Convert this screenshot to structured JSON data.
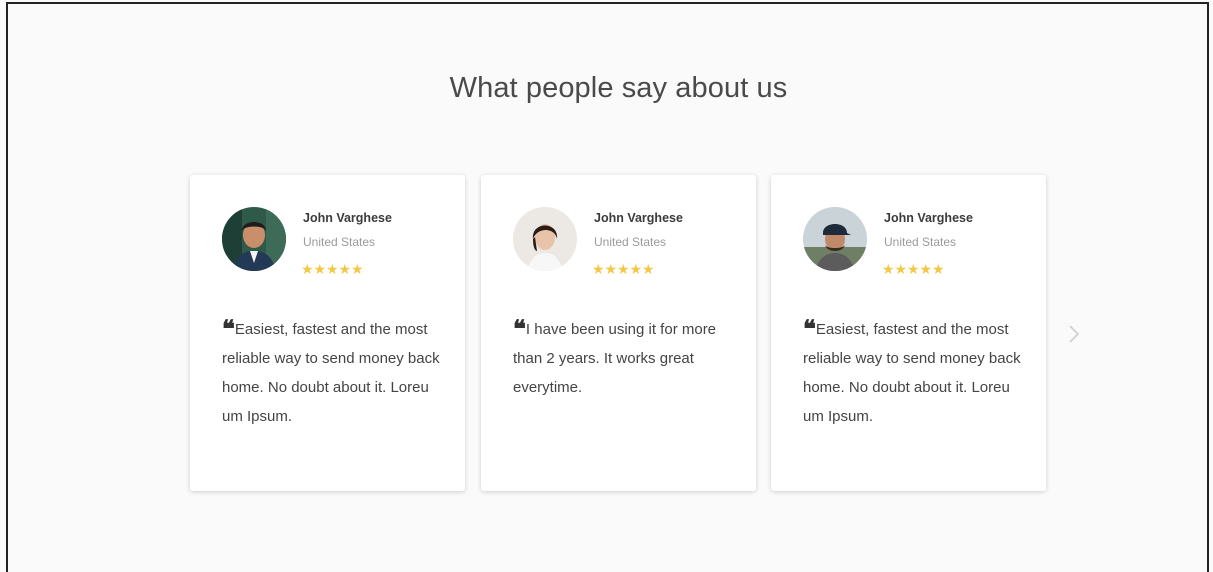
{
  "section": {
    "title": "What people say about us"
  },
  "testimonials": [
    {
      "name": "John Varghese",
      "country": "United States",
      "rating": 5,
      "quote": "Easiest, fastest and the most reliable way to send money back home. No doubt about it. Loreu um Ipsum."
    },
    {
      "name": "John Varghese",
      "country": "United States",
      "rating": 5,
      "quote": "I have been using it for more than 2 years. It works great everytime."
    },
    {
      "name": "John Varghese",
      "country": "United States",
      "rating": 5,
      "quote": "Easiest, fastest and the most reliable way to send money back home. No doubt about it. Loreu um Ipsum."
    }
  ],
  "icons": {
    "star": "star-icon",
    "quote": "quote-icon",
    "next": "chevron-right-icon"
  },
  "colors": {
    "star": "#f3c846",
    "heading": "#4a4a4a",
    "background": "#fafafa"
  }
}
